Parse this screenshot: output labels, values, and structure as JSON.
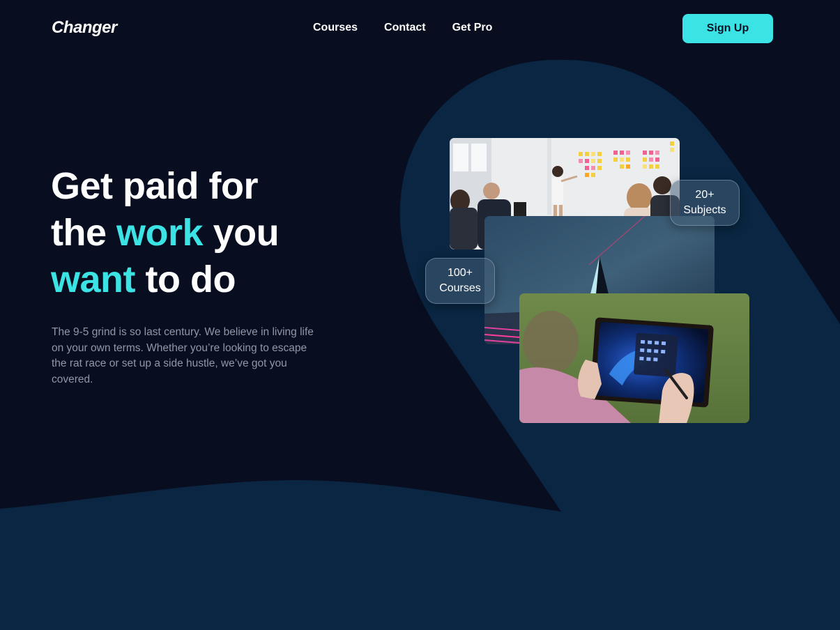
{
  "brand": {
    "logo": "Changer"
  },
  "nav": {
    "items": [
      {
        "label": "Courses"
      },
      {
        "label": "Contact"
      },
      {
        "label": "Get Pro"
      }
    ],
    "signup_label": "Sign Up"
  },
  "hero": {
    "headline": {
      "line1": "Get paid for",
      "line2_start": "the ",
      "line2_accent": "work",
      "line2_end": " you",
      "line3_accent": "want",
      "line3_end": " to do"
    },
    "description": "The 9-5 grind is so last century. We believe in living life on your own terms. Whether you’re looking to escape the rat race or set up a side hustle, we’ve got you covered."
  },
  "badges": {
    "subjects": {
      "value": "20+",
      "label": "Subjects"
    },
    "courses": {
      "value": "100+",
      "label": "Courses"
    }
  },
  "colors": {
    "background": "#080d20",
    "shape": "#0a2642",
    "accent": "#3ce3e4"
  }
}
